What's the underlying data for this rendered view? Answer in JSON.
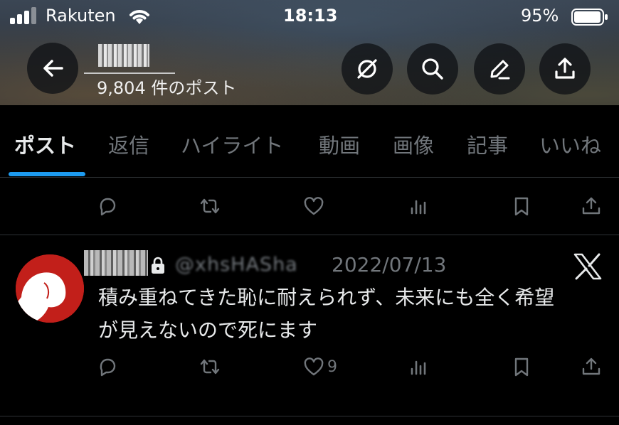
{
  "status_bar": {
    "carrier": "Rakuten",
    "time": "18:13",
    "battery": "95%"
  },
  "header": {
    "post_count": "9,804 件のポスト"
  },
  "tabs": [
    {
      "label": "ポスト",
      "active": true
    },
    {
      "label": "返信",
      "active": false
    },
    {
      "label": "ハイライト",
      "active": false
    },
    {
      "label": "動画",
      "active": false
    },
    {
      "label": "画像",
      "active": false
    },
    {
      "label": "記事",
      "active": false
    },
    {
      "label": "いいね",
      "active": false
    }
  ],
  "tweet": {
    "handle": "@xhsHASha",
    "date": "2022/07/13",
    "text_line1": "積み重ねてきた恥に耐えられず、未来にも全く希望",
    "text_line2": "が見えないので死にます",
    "like_count": "9"
  },
  "colors": {
    "accent": "#1d9bf0",
    "muted": "#71767b",
    "text": "#e7e9ea",
    "divider": "#2f3336",
    "avatar_red": "#c21f1a"
  }
}
